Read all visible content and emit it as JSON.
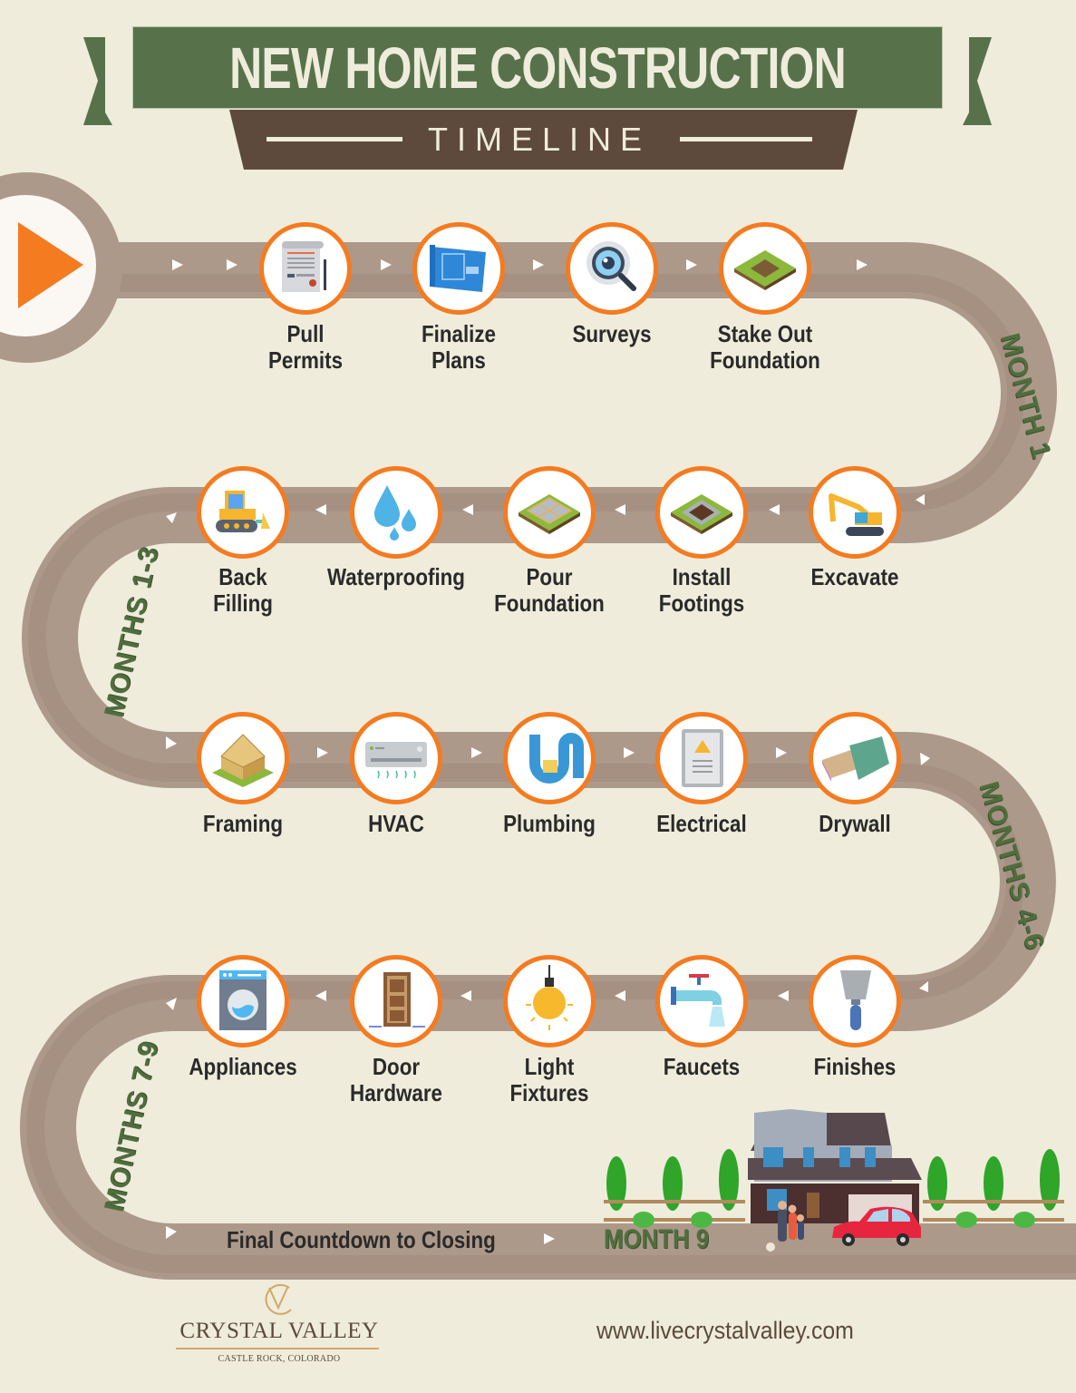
{
  "header": {
    "title": "NEW HOME CONSTRUCTION",
    "subtitle": "TIMELINE"
  },
  "colors": {
    "background": "#efecdc",
    "banner_green": "#57724a",
    "banner_brown": "#5e4a3c",
    "road": "#ad998a",
    "road_dark": "#9c8677",
    "accent_orange": "#f47b20",
    "label_dark": "#2a2a2a",
    "month_green": "#4f6e3e"
  },
  "start_icon": "play-arrow-icon",
  "rows": [
    {
      "direction": "right",
      "steps": [
        {
          "label_lines": [
            "Pull",
            "Permits"
          ],
          "icon": "permit-document-icon"
        },
        {
          "label_lines": [
            "Finalize",
            "Plans"
          ],
          "icon": "blueprint-icon"
        },
        {
          "label_lines": [
            "Surveys"
          ],
          "icon": "magnifier-eye-icon"
        },
        {
          "label_lines": [
            "Stake Out",
            "Foundation"
          ],
          "icon": "staked-lot-icon"
        }
      ]
    },
    {
      "direction": "left",
      "steps": [
        {
          "label_lines": [
            "Excavate"
          ],
          "icon": "excavator-icon"
        },
        {
          "label_lines": [
            "Install",
            "Footings"
          ],
          "icon": "footings-icon"
        },
        {
          "label_lines": [
            "Pour",
            "Foundation"
          ],
          "icon": "foundation-slab-icon"
        },
        {
          "label_lines": [
            "Waterproofing"
          ],
          "icon": "water-drops-icon"
        },
        {
          "label_lines": [
            "Back",
            "Filling"
          ],
          "icon": "bulldozer-icon"
        }
      ]
    },
    {
      "direction": "right",
      "steps": [
        {
          "label_lines": [
            "Framing"
          ],
          "icon": "house-frame-icon"
        },
        {
          "label_lines": [
            "HVAC"
          ],
          "icon": "air-conditioner-icon"
        },
        {
          "label_lines": [
            "Plumbing"
          ],
          "icon": "pipe-icon"
        },
        {
          "label_lines": [
            "Electrical"
          ],
          "icon": "electrical-panel-icon"
        },
        {
          "label_lines": [
            "Drywall"
          ],
          "icon": "drywall-sheet-icon"
        }
      ]
    },
    {
      "direction": "left",
      "steps": [
        {
          "label_lines": [
            "Finishes"
          ],
          "icon": "putty-knife-icon"
        },
        {
          "label_lines": [
            "Faucets"
          ],
          "icon": "faucet-icon"
        },
        {
          "label_lines": [
            "Light",
            "Fixtures"
          ],
          "icon": "light-bulb-icon"
        },
        {
          "label_lines": [
            "Door",
            "Hardware"
          ],
          "icon": "door-icon"
        },
        {
          "label_lines": [
            "Appliances"
          ],
          "icon": "washing-machine-icon"
        }
      ]
    }
  ],
  "month_labels": {
    "month_1": "MONTH 1",
    "months_1_3": "MONTHS 1-3",
    "months_4_6": "MONTHS 4-6",
    "months_7_9": "MONTHS 7-9",
    "month_9": "MONTH 9"
  },
  "final_stretch": {
    "label": "Final Countdown to Closing",
    "illustration": "house-family-car-illustration"
  },
  "footer": {
    "logo_name": "CRYSTAL VALLEY",
    "logo_tagline": "CASTLE ROCK, COLORADO",
    "website": "www.livecrystalvalley.com"
  }
}
